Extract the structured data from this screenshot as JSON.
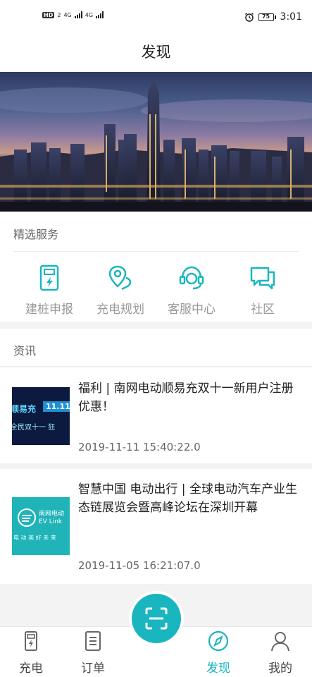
{
  "status_bar": {
    "network_left": "HD",
    "network_sim": "2",
    "net1": "4G",
    "net2": "4G",
    "battery": "75",
    "time": "3:01"
  },
  "header": {
    "title": "发现"
  },
  "services": {
    "title": "精选服务",
    "items": [
      {
        "label": "建桩申报",
        "icon": "charging-pile-icon"
      },
      {
        "label": "充电规划",
        "icon": "route-pin-icon"
      },
      {
        "label": "客服中心",
        "icon": "headset-icon"
      },
      {
        "label": "社区",
        "icon": "chat-bubbles-icon"
      }
    ]
  },
  "news": {
    "title": "资讯",
    "items": [
      {
        "headline": "福利 | 南网电动顺易充双十一新用户注册优惠！",
        "date": "2019-11-11 15:40:22.0",
        "thumb_text_1": "顺易充",
        "thumb_text_2": "11.11",
        "thumb_text_3": "全民双十一  狂"
      },
      {
        "headline": "智慧中国 电动出行 | 全球电动汽车产业生态链展览会暨高峰论坛在深圳开幕",
        "date": "2019-11-05 16:21:07.0",
        "thumb_text_1": "南网电动",
        "thumb_text_2": "EV Link",
        "thumb_text_3": "电 动 美 好 未 来"
      }
    ]
  },
  "tabbar": {
    "items": [
      {
        "label": "充电",
        "icon": "charger-icon"
      },
      {
        "label": "订单",
        "icon": "order-list-icon"
      },
      {
        "label": "发现",
        "icon": "compass-icon",
        "active": true
      },
      {
        "label": "我的",
        "icon": "person-icon"
      }
    ],
    "scan_icon": "scan-icon"
  },
  "colors": {
    "accent": "#1ab6bf",
    "muted_text": "#999999"
  }
}
